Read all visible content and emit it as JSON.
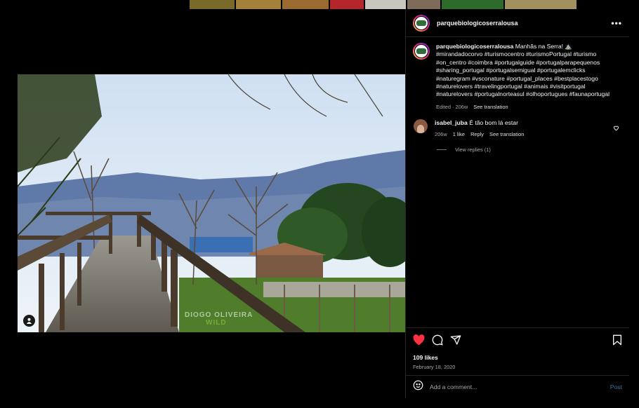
{
  "account": {
    "username": "parquebiologicoserralousa"
  },
  "header": {
    "more_icon": "more-horizontal-icon"
  },
  "caption": {
    "username": "parquebiologicoserralousa",
    "text": "Manhãs na Serra! ⛰️",
    "hashtags": "#mirandadocorvo #turismocentro #turismoPortugal #turismo #on_centro #coimbra #portugalguide #portugalparapequenos #sharing_portugal #portugalsemigual #portugalemclicks #naturegram #vsconature #portugal_places #bestplacestogo #naturelovers #travelingportugal #animais #visitportugal #naturelovers #portugalnorteasul #olhoportugues #faunaportugal",
    "edited": "Edited · 206w",
    "see_translation": "See translation"
  },
  "comment": {
    "username": "isabel_juba",
    "text": "É tão bom lá estar",
    "age": "206w",
    "likes": "1 like",
    "reply": "Reply",
    "see_translation": "See translation",
    "view_replies": "View replies (1)"
  },
  "watermark": {
    "line1": "DIOGO OLIVEIRA",
    "line2": "WILD"
  },
  "actions": {
    "likes": "109 likes",
    "date": "February 18, 2020"
  },
  "add_comment": {
    "placeholder": "Add a comment...",
    "post": "Post"
  },
  "colors": {
    "like_red": "#ff3040",
    "post_blue": "#0095f6",
    "border": "#262626"
  }
}
